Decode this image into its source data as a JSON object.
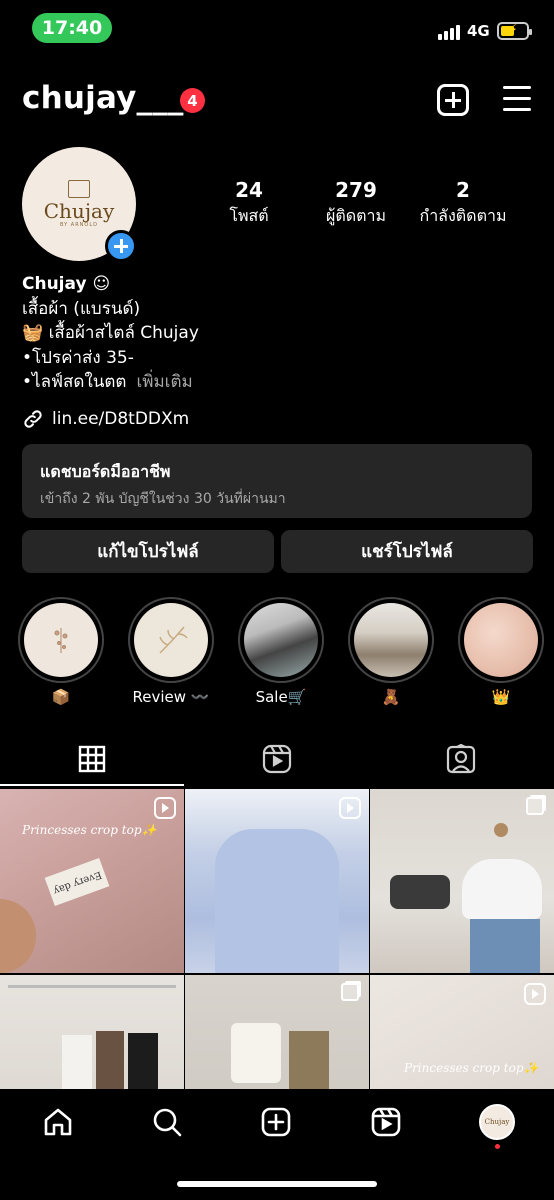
{
  "status_bar": {
    "time": "17:40",
    "network": "4G"
  },
  "header": {
    "username": "chujay___",
    "notification_count": "4"
  },
  "profile": {
    "avatar_text": "Chujay",
    "avatar_subtext": "BY ARNOLD",
    "stats": [
      {
        "value": "24",
        "label": "โพสต์"
      },
      {
        "value": "279",
        "label": "ผู้ติดตาม"
      },
      {
        "value": "2",
        "label": "กำลังติดตาม"
      }
    ],
    "display_name": "Chujay ☺︎",
    "category": "เสื้อผ้า (แบรนด์)",
    "bio_lines": [
      "🧺 เสื้อผ้าสไตล์ Chujay",
      "•โปรค่าส่ง 35-",
      "•ไลฟ์สดในตต"
    ],
    "more_label": "เพิ่มเติม",
    "link": "lin.ee/D8tDDXm"
  },
  "dashboard": {
    "title": "แดชบอร์ดมืออาชีพ",
    "subtitle": "เข้าถึง 2 พัน บัญชีในช่วง 30 วันที่ผ่านมา"
  },
  "buttons": {
    "edit": "แก้ไขโปรไฟล์",
    "share": "แชร์โปรไฟล์"
  },
  "highlights": [
    {
      "label": "📦"
    },
    {
      "label": "Review 〰️"
    },
    {
      "label": "Sale🛒"
    },
    {
      "label": "🧸"
    },
    {
      "label": "👑"
    }
  ],
  "grid": {
    "captions": [
      "Princesses crop top✨",
      "Princesses crop top✨"
    ],
    "tag_text": "Every day"
  },
  "colors": {
    "accent": "#3897f0",
    "badge": "#ff3040",
    "status_green": "#34c759",
    "card": "#262626"
  }
}
